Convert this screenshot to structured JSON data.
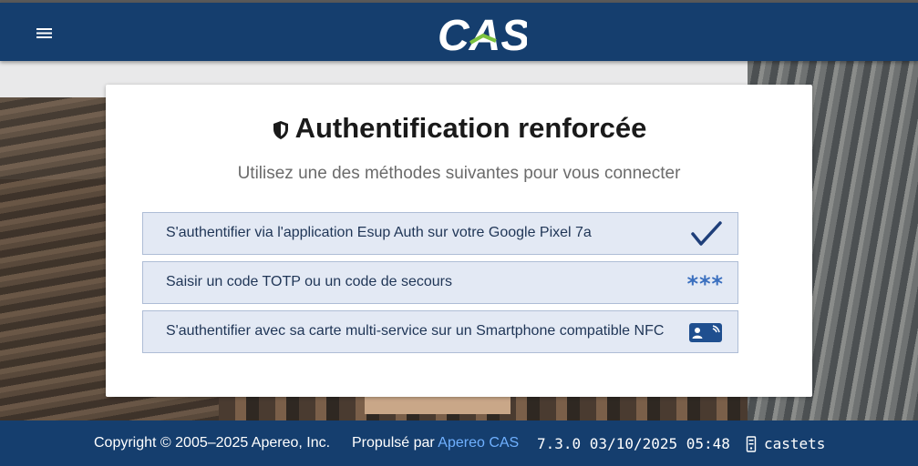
{
  "header": {
    "logo_text": "CAS",
    "menu_icon": "hamburger-menu-icon"
  },
  "card": {
    "title_icon": "shield-icon",
    "title": "Authentification renforcée",
    "subtitle": "Utilisez une des méthodes suivantes pour vous connecter",
    "options": [
      {
        "label": "S'authentifier via l'application Esup Auth sur votre Google Pixel 7a",
        "icon": "checkmark-icon"
      },
      {
        "label": "Saisir un code TOTP ou un code de secours",
        "icon": "asterisks-icon",
        "icon_text": "***"
      },
      {
        "label": "S'authentifier avec sa carte multi-service sur un Smartphone compatible NFC",
        "icon": "nfc-card-icon"
      }
    ]
  },
  "footer": {
    "copyright": "Copyright © 2005–2025 Apereo, Inc.",
    "powered_prefix": "Propulsé par ",
    "powered_link": "Apereo CAS",
    "version": "7.3.0 03/10/2025 05:48",
    "server_icon": "server-icon",
    "host": "castets"
  },
  "colors": {
    "header_bg": "#153e6e",
    "option_bg": "#e3e9f4",
    "option_border": "#aebdd6",
    "link": "#6fb0ff",
    "logo_accent": "#7cc23f"
  }
}
